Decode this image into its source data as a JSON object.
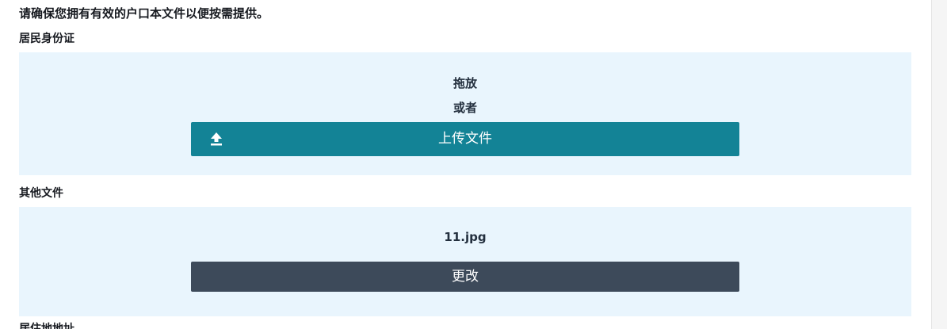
{
  "notice": "请确保您拥有有效的户口本文件以便按需提供。",
  "sections": {
    "id_card": {
      "label": "居民身份证",
      "drag_text": "拖放",
      "or_text": "或者",
      "upload_button": "上传文件",
      "upload_icon": "upload-icon"
    },
    "other_docs": {
      "label": "其他文件",
      "file_name": "11.jpg",
      "change_button": "更改"
    },
    "address": {
      "label": "居住地地址"
    }
  },
  "colors": {
    "dropzone_bg": "#e9f5fd",
    "upload_button": "#138396",
    "change_button": "#3d4a5a",
    "text": "#16191f"
  }
}
